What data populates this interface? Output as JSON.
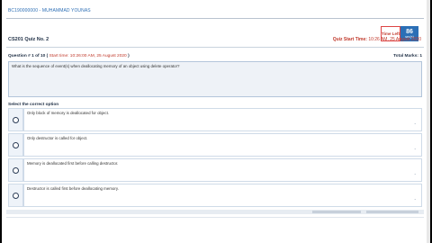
{
  "header": {
    "student_name": "BC190000000 - MUHAMMAD YOUNAS",
    "quiz_title": "CS201 Quiz No. 2",
    "quiz_start_label": "Quiz Start Time:",
    "quiz_start_value": "10:26 AM, 25 August 2020",
    "timer_label": "Time Left",
    "timer_value": "86",
    "timer_unit": "sec(s)"
  },
  "question": {
    "number_label": "Question # 1 of 10 (",
    "start_label": "Start time: 10:26:00 AM, 25 August 2020",
    "number_suffix": ")",
    "total_marks_label": "Total Marks: 1",
    "text": "What is the sequence of event(s) when deallocating memory of an object using delete operator?"
  },
  "select_label": "Select the correct option",
  "options": [
    {
      "text": "Only block of memory is deallocated for object."
    },
    {
      "text": "Only destructor is called for object."
    },
    {
      "text": "Memory is deallocated first before calling destructor."
    },
    {
      "text": "Destructor is called first before deallocating memory."
    }
  ],
  "colors": {
    "accent": "#2b6fb6",
    "warning": "#c0392b"
  }
}
